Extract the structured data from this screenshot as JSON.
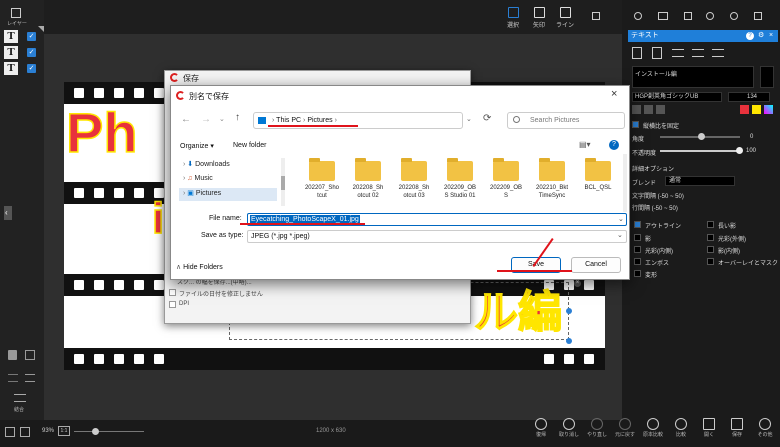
{
  "left_panel": {
    "title": "レイヤー",
    "layer_glyph": "T",
    "delete_label": "",
    "merge_label": "結合"
  },
  "top_toolbar": {
    "tools": [
      "選択",
      "矢印",
      "ライン"
    ]
  },
  "canvas": {
    "big_text_1": "Ph",
    "big_text_2": "i",
    "big_text_3": "ル編",
    "behind_dialog_lines": [
      "スク... の幅を保存...(中略)...",
      "ファイルの日付を修正しません",
      "DPI"
    ]
  },
  "behind_dialog": {
    "title": "保存"
  },
  "save_dialog": {
    "title": "別名で保存",
    "breadcrumb": [
      "This PC",
      "Pictures"
    ],
    "search_placeholder": "Search Pictures",
    "organize_label": "Organize ▾",
    "new_folder_label": "New folder",
    "nav_items": [
      "Downloads",
      "Music",
      "Pictures"
    ],
    "folders": [
      "202207_Sho\ntcut",
      "202208_Sh\notcut 02",
      "202208_Sh\notcut 03",
      "202209_OB\nS Studio 01",
      "202209_OB\nS",
      "202210_Bkt\nTimeSync",
      "BCL_QSL"
    ],
    "file_name_label": "File name:",
    "file_name_value": "Eyecatching_PhotoScapeX_01.jpg",
    "save_type_label": "Save as type:",
    "save_type_value": "JPEG (*.jpg *.jpeg)",
    "hide_folders_label": "Hide Folders",
    "save_button": "Save",
    "cancel_button": "Cancel",
    "accent_color": "#0067c0"
  },
  "right_panel": {
    "title": "テキスト",
    "install_label": "インストール編",
    "font_name": "HGP創英角ゴシックUB",
    "font_size": "134",
    "vertical_label": "縦横比を固定",
    "bold_label": "",
    "angle_label": "角度",
    "angle_value": "0",
    "opacity_label": "不透明度",
    "opacity_value": "100",
    "detail_label": "詳細オプション",
    "blend_label": "ブレンド",
    "blend_value": "通常",
    "char_spacing": "文字間隔 (-50 ~ 50)",
    "line_spacing": "行間隔 (-50 ~ 50)",
    "effects": [
      "アウトライン",
      "長い影",
      "影",
      "光彩(外側)",
      "光彩(内側)",
      "影(内側)",
      "エンボス",
      "オーバーレイとマスク",
      "変形"
    ]
  },
  "bottom_bar": {
    "zoom": "93%",
    "ratio": "1:1",
    "dimensions": "1200 x 630",
    "actions": [
      "復帰",
      "取り消し",
      "やり直し",
      "元に戻す",
      "原本比較",
      "比較",
      "開く",
      "保存",
      "その他"
    ]
  }
}
